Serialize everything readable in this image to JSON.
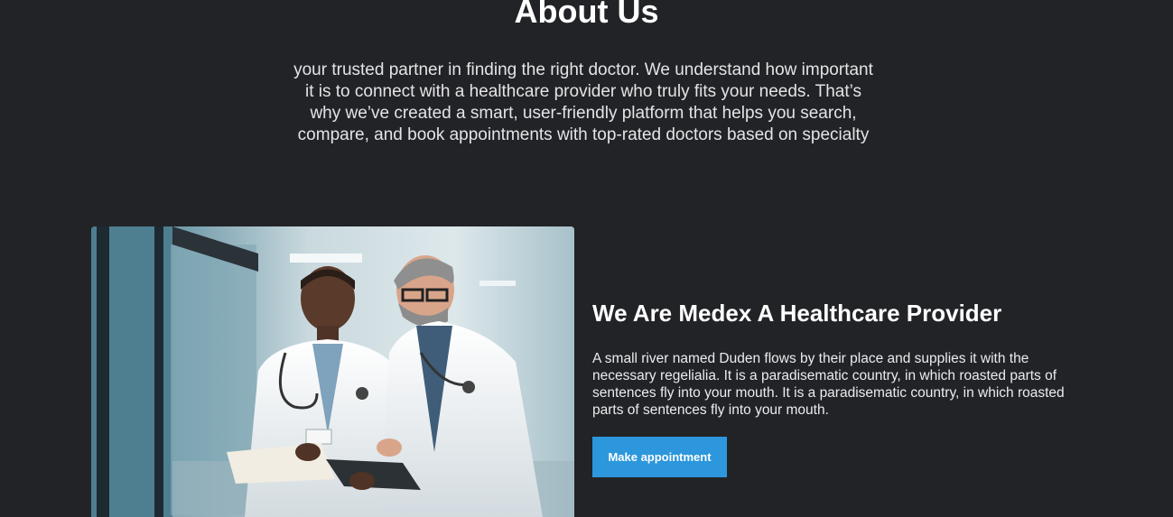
{
  "about": {
    "heading": "About Us",
    "intro": "your trusted partner in finding the right doctor. We understand how important it is to connect with a healthcare provider who truly fits your needs. That’s why we’ve created a smart, user-friendly platform that helps you search, compare, and book appointments with top-rated doctors based on specialty"
  },
  "feature": {
    "image_subject": "two doctors reviewing a tablet in a hospital corridor",
    "title": "We Are Medex A Healthcare Provider",
    "text": "A small river named Duden flows by their place and supplies it with the necessary regelialia. It is a paradisematic country, in which roasted parts of sentences fly into your mouth. It is a paradisematic country, in which roasted parts of sentences fly into your mouth.",
    "button_label": "Make appointment"
  },
  "colors": {
    "background": "#222327",
    "accent": "#2c97dc",
    "text": "#ffffff"
  }
}
